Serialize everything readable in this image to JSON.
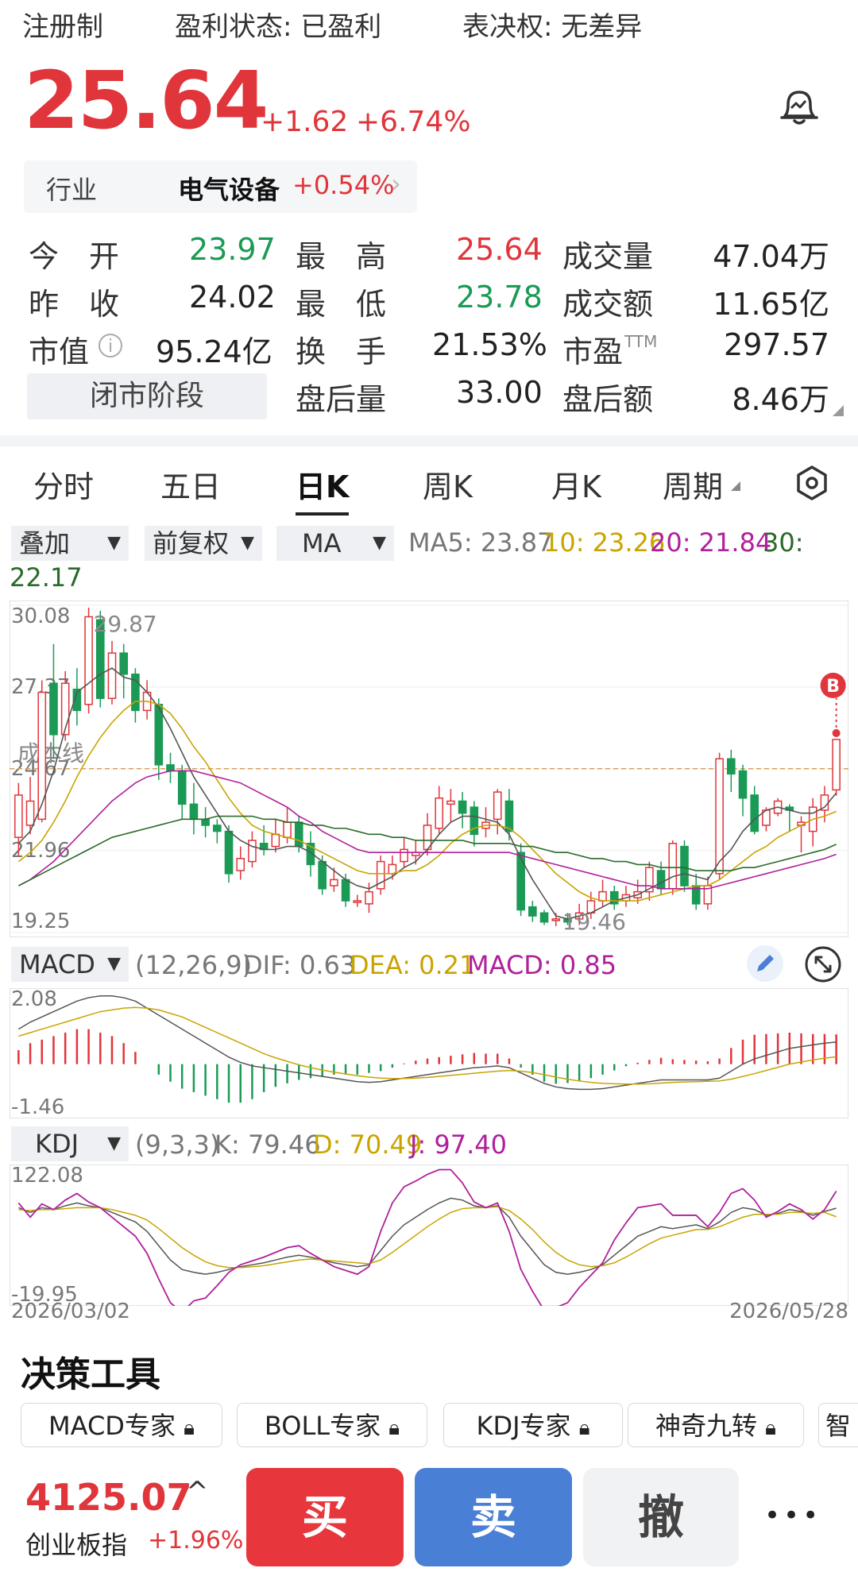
{
  "header": {
    "registration": "注册制",
    "profit_status": "盈利状态: 已盈利",
    "voting": "表决权: 无差异"
  },
  "price": {
    "current": "25.64",
    "change": "+1.62",
    "change_pct": "+6.74%"
  },
  "industry": {
    "label": "行业",
    "name": "电气设备",
    "change": "+0.54%"
  },
  "quote": {
    "open_label": "今　开",
    "open": "23.97",
    "high_label": "最　高",
    "high": "25.64",
    "volume_label": "成交量",
    "volume": "47.04万",
    "prev_close_label": "昨　收",
    "prev_close": "24.02",
    "low_label": "最　低",
    "low": "23.78",
    "turnover_label": "成交额",
    "turnover": "11.65亿",
    "mktcap_label": "市值",
    "mktcap": "95.24亿",
    "turnover_rate_label": "换　手",
    "turnover_rate": "21.53%",
    "pe_label": "市盈",
    "pe_suffix": "TTM",
    "pe": "297.57",
    "closed_label": "闭市阶段",
    "after_vol_label": "盘后量",
    "after_vol": "33.00",
    "after_amt_label": "盘后额",
    "after_amt": "8.46万"
  },
  "tabs": [
    "分时",
    "五日",
    "日K",
    "周K",
    "月K",
    "周期"
  ],
  "chart_controls": {
    "overlay": "叠加",
    "adjust": "前复权",
    "indicator": "MA",
    "ma5": "MA5: 23.87",
    "ma10": "10: 23.26",
    "ma20": "20: 21.84",
    "ma30_label": "30:",
    "ma30": "22.17"
  },
  "colors": {
    "up": "#e0353b",
    "down": "#1a9a55",
    "ma5": "#555555",
    "ma10": "#c9a400",
    "ma20": "#b0209a",
    "ma30": "#2a6a2a",
    "buy_button": "#e8373c",
    "sell_button": "#4a7fd6"
  },
  "chart_data": {
    "type": "candlestick",
    "y_ticks": [
      "30.08",
      "27.37",
      "24.67",
      "21.96",
      "19.25"
    ],
    "ylim": [
      19.25,
      30.08
    ],
    "max_label": "29.87",
    "min_label": "19.46",
    "cost_line_label": "成本线",
    "cost_line": 24.67,
    "signal_marker": "B",
    "x_start": "2026/03/02",
    "x_end": "2026/05/28",
    "candles": [
      [
        22.4,
        23.8,
        21.8,
        24.2
      ],
      [
        22.8,
        23.6,
        22.5,
        24.4
      ],
      [
        23.0,
        27.2,
        22.9,
        27.6
      ],
      [
        27.5,
        25.8,
        25.0,
        28.8
      ],
      [
        25.8,
        27.5,
        25.6,
        27.9
      ],
      [
        27.3,
        26.6,
        26.1,
        28.0
      ],
      [
        26.8,
        29.7,
        26.5,
        30.0
      ],
      [
        29.6,
        27.0,
        26.7,
        29.9
      ],
      [
        27.0,
        28.5,
        26.8,
        28.9
      ],
      [
        28.5,
        27.8,
        27.0,
        28.8
      ],
      [
        27.8,
        26.6,
        26.2,
        28.0
      ],
      [
        26.6,
        27.2,
        26.3,
        27.6
      ],
      [
        26.8,
        24.8,
        24.3,
        27.0
      ],
      [
        24.8,
        24.6,
        24.2,
        25.2
      ],
      [
        24.6,
        23.5,
        23.0,
        24.8
      ],
      [
        23.5,
        23.0,
        22.5,
        24.2
      ],
      [
        23.0,
        22.8,
        22.4,
        23.4
      ],
      [
        22.8,
        22.6,
        22.2,
        23.0
      ],
      [
        22.6,
        21.2,
        20.9,
        22.8
      ],
      [
        21.3,
        21.7,
        21.0,
        22.1
      ],
      [
        21.6,
        22.3,
        21.4,
        22.6
      ],
      [
        22.2,
        22.0,
        21.8,
        22.8
      ],
      [
        22.1,
        22.5,
        21.9,
        23.0
      ],
      [
        22.4,
        22.9,
        22.2,
        23.4
      ],
      [
        22.9,
        22.1,
        21.9,
        23.1
      ],
      [
        22.2,
        21.5,
        21.1,
        22.6
      ],
      [
        21.6,
        20.7,
        20.5,
        21.8
      ],
      [
        20.8,
        21.0,
        20.6,
        21.4
      ],
      [
        21.0,
        20.3,
        20.1,
        21.2
      ],
      [
        20.3,
        20.3,
        20.1,
        20.5
      ],
      [
        20.2,
        20.6,
        19.9,
        20.9
      ],
      [
        20.7,
        21.6,
        20.5,
        21.8
      ],
      [
        21.2,
        21.5,
        21.0,
        21.8
      ],
      [
        21.6,
        22.0,
        21.4,
        22.4
      ],
      [
        21.8,
        21.9,
        21.5,
        22.3
      ],
      [
        22.0,
        22.8,
        21.8,
        23.2
      ],
      [
        22.7,
        23.7,
        22.5,
        24.1
      ],
      [
        23.5,
        23.6,
        22.9,
        24.0
      ],
      [
        23.6,
        23.2,
        22.7,
        23.9
      ],
      [
        23.4,
        22.5,
        22.1,
        23.6
      ],
      [
        22.7,
        22.9,
        22.4,
        23.4
      ],
      [
        23.0,
        23.9,
        22.5,
        24.0
      ],
      [
        23.6,
        22.6,
        22.3,
        24.0
      ],
      [
        21.9,
        20.0,
        19.8,
        22.2
      ],
      [
        20.1,
        19.8,
        19.6,
        20.3
      ],
      [
        19.9,
        19.6,
        19.5,
        20.0
      ],
      [
        19.7,
        19.7,
        19.46,
        19.9
      ],
      [
        19.7,
        19.6,
        19.5,
        19.9
      ],
      [
        19.7,
        19.9,
        19.5,
        20.2
      ],
      [
        19.9,
        20.3,
        19.7,
        20.6
      ],
      [
        20.3,
        20.6,
        20.1,
        21.0
      ],
      [
        20.6,
        20.2,
        20.0,
        20.8
      ],
      [
        20.3,
        20.5,
        20.1,
        20.8
      ],
      [
        20.4,
        20.6,
        20.2,
        21.0
      ],
      [
        20.6,
        21.4,
        20.3,
        21.6
      ],
      [
        21.3,
        20.7,
        20.5,
        21.6
      ],
      [
        20.7,
        22.2,
        20.5,
        22.3
      ],
      [
        22.1,
        20.8,
        20.6,
        22.3
      ],
      [
        20.8,
        20.2,
        20.0,
        21.2
      ],
      [
        20.2,
        20.8,
        20.0,
        21.1
      ],
      [
        21.2,
        25.0,
        21.0,
        25.2
      ],
      [
        25.0,
        24.5,
        23.9,
        25.3
      ],
      [
        24.6,
        23.7,
        23.1,
        24.8
      ],
      [
        23.8,
        22.6,
        22.5,
        24.1
      ],
      [
        22.8,
        23.3,
        22.6,
        23.4
      ],
      [
        23.2,
        23.6,
        23.1,
        23.7
      ],
      [
        23.4,
        23.3,
        22.6,
        23.5
      ],
      [
        22.8,
        22.9,
        21.9,
        23.1
      ],
      [
        22.6,
        23.4,
        22.1,
        23.7
      ],
      [
        23.3,
        23.8,
        22.9,
        24.1
      ],
      [
        23.97,
        25.64,
        23.78,
        25.64
      ]
    ],
    "ma": {
      "MA5": [
        22.2,
        22.6,
        23.5,
        24.6,
        26.0,
        27.2,
        27.5,
        27.8,
        28.0,
        27.7,
        27.6,
        27.2,
        26.7,
        26.0,
        25.2,
        24.4,
        23.8,
        23.2,
        22.6,
        22.3,
        22.1,
        22.0,
        22.0,
        22.1,
        22.1,
        21.9,
        21.6,
        21.3,
        21.0,
        20.8,
        20.7,
        20.9,
        21.1,
        21.4,
        21.6,
        22.0,
        22.5,
        22.9,
        23.1,
        23.1,
        23.0,
        22.9,
        22.5,
        21.7,
        21.0,
        20.4,
        19.8,
        19.7,
        19.8,
        19.9,
        20.1,
        20.3,
        20.4,
        20.5,
        20.7,
        20.9,
        21.1,
        21.2,
        21.1,
        21.0,
        21.6,
        22.0,
        22.6,
        23.0,
        23.3,
        23.4,
        23.3,
        23.2,
        23.2,
        23.4,
        23.87
      ],
      "MA10": [
        21.6,
        21.9,
        22.3,
        22.9,
        23.6,
        24.4,
        25.1,
        25.7,
        26.2,
        26.6,
        26.9,
        26.9,
        26.8,
        26.5,
        26.0,
        25.4,
        24.9,
        24.3,
        23.7,
        23.2,
        22.8,
        22.6,
        22.5,
        22.4,
        22.3,
        22.1,
        21.9,
        21.7,
        21.5,
        21.3,
        21.2,
        21.2,
        21.2,
        21.3,
        21.3,
        21.5,
        21.8,
        22.2,
        22.5,
        22.7,
        22.8,
        22.8,
        22.7,
        22.4,
        22.0,
        21.6,
        21.2,
        20.9,
        20.6,
        20.4,
        20.3,
        20.3,
        20.3,
        20.3,
        20.4,
        20.5,
        20.6,
        20.7,
        20.8,
        20.8,
        21.0,
        21.3,
        21.6,
        21.9,
        22.1,
        22.4,
        22.6,
        22.8,
        23.0,
        23.1,
        23.26
      ],
      "MA20": [
        20.8,
        21.0,
        21.3,
        21.6,
        22.0,
        22.4,
        22.8,
        23.2,
        23.6,
        23.9,
        24.2,
        24.4,
        24.5,
        24.6,
        24.6,
        24.6,
        24.5,
        24.4,
        24.3,
        24.2,
        24.0,
        23.8,
        23.6,
        23.4,
        23.1,
        22.9,
        22.6,
        22.4,
        22.2,
        22.0,
        21.9,
        21.9,
        21.9,
        21.9,
        21.9,
        21.9,
        21.9,
        21.9,
        21.9,
        21.9,
        21.9,
        21.9,
        21.9,
        21.8,
        21.7,
        21.6,
        21.5,
        21.4,
        21.3,
        21.2,
        21.1,
        21.0,
        20.9,
        20.8,
        20.8,
        20.7,
        20.7,
        20.7,
        20.7,
        20.7,
        20.8,
        20.9,
        21.0,
        21.1,
        21.2,
        21.3,
        21.4,
        21.5,
        21.6,
        21.7,
        21.84
      ],
      "MA30": [
        20.8,
        21.0,
        21.2,
        21.4,
        21.6,
        21.8,
        22.0,
        22.2,
        22.4,
        22.5,
        22.6,
        22.7,
        22.8,
        22.9,
        23.0,
        23.0,
        23.0,
        23.1,
        23.1,
        23.1,
        23.1,
        23.0,
        23.0,
        22.9,
        22.9,
        22.8,
        22.8,
        22.7,
        22.7,
        22.6,
        22.5,
        22.5,
        22.4,
        22.4,
        22.3,
        22.3,
        22.3,
        22.3,
        22.3,
        22.2,
        22.2,
        22.2,
        22.2,
        22.1,
        22.1,
        22.0,
        21.9,
        21.9,
        21.8,
        21.7,
        21.7,
        21.6,
        21.6,
        21.5,
        21.5,
        21.4,
        21.4,
        21.4,
        21.3,
        21.3,
        21.3,
        21.3,
        21.4,
        21.4,
        21.5,
        21.6,
        21.7,
        21.8,
        21.9,
        22.0,
        22.17
      ]
    },
    "macd": {
      "label": "MACD",
      "params": "(12,26,9)",
      "dif_label": "DIF: 0.63",
      "dea_label": "DEA: 0.21",
      "macd_label": "MACD: 0.85",
      "y_ticks": [
        "2.08",
        "-1.46"
      ],
      "ylim": [
        -1.46,
        2.08
      ],
      "dif": [
        1.0,
        1.2,
        1.35,
        1.5,
        1.65,
        1.8,
        1.9,
        1.95,
        1.95,
        1.9,
        1.8,
        1.6,
        1.4,
        1.2,
        1.0,
        0.8,
        0.6,
        0.4,
        0.2,
        0.05,
        -0.05,
        -0.1,
        -0.15,
        -0.2,
        -0.25,
        -0.3,
        -0.35,
        -0.4,
        -0.45,
        -0.5,
        -0.52,
        -0.5,
        -0.45,
        -0.4,
        -0.35,
        -0.3,
        -0.25,
        -0.2,
        -0.15,
        -0.1,
        -0.08,
        -0.05,
        -0.1,
        -0.25,
        -0.4,
        -0.55,
        -0.65,
        -0.7,
        -0.72,
        -0.72,
        -0.7,
        -0.65,
        -0.6,
        -0.55,
        -0.5,
        -0.45,
        -0.45,
        -0.45,
        -0.45,
        -0.45,
        -0.4,
        -0.2,
        0.0,
        0.15,
        0.25,
        0.35,
        0.45,
        0.5,
        0.55,
        0.6,
        0.63
      ],
      "dea": [
        0.8,
        0.9,
        1.0,
        1.1,
        1.2,
        1.3,
        1.4,
        1.5,
        1.55,
        1.6,
        1.62,
        1.6,
        1.55,
        1.45,
        1.35,
        1.2,
        1.05,
        0.9,
        0.75,
        0.6,
        0.45,
        0.3,
        0.18,
        0.08,
        -0.02,
        -0.1,
        -0.17,
        -0.23,
        -0.28,
        -0.33,
        -0.37,
        -0.4,
        -0.41,
        -0.41,
        -0.4,
        -0.38,
        -0.35,
        -0.32,
        -0.29,
        -0.26,
        -0.23,
        -0.2,
        -0.18,
        -0.2,
        -0.24,
        -0.3,
        -0.37,
        -0.43,
        -0.48,
        -0.52,
        -0.55,
        -0.56,
        -0.57,
        -0.57,
        -0.56,
        -0.54,
        -0.52,
        -0.51,
        -0.5,
        -0.49,
        -0.48,
        -0.43,
        -0.35,
        -0.27,
        -0.18,
        -0.09,
        0.0,
        0.06,
        0.12,
        0.17,
        0.21
      ],
      "hist": [
        0.4,
        0.6,
        0.7,
        0.8,
        0.9,
        1.0,
        1.0,
        0.9,
        0.8,
        0.6,
        0.35,
        0.0,
        -0.3,
        -0.5,
        -0.7,
        -0.8,
        -0.9,
        -1.0,
        -1.1,
        -1.1,
        -1.0,
        -0.8,
        -0.65,
        -0.55,
        -0.45,
        -0.4,
        -0.35,
        -0.3,
        -0.3,
        -0.3,
        -0.25,
        -0.2,
        -0.1,
        0.02,
        0.1,
        0.16,
        0.2,
        0.24,
        0.28,
        0.32,
        0.3,
        0.3,
        0.16,
        -0.1,
        -0.3,
        -0.5,
        -0.56,
        -0.54,
        -0.48,
        -0.4,
        -0.3,
        -0.18,
        -0.06,
        0.04,
        0.12,
        0.18,
        0.14,
        0.12,
        0.1,
        0.08,
        0.16,
        0.46,
        0.7,
        0.84,
        0.86,
        0.88,
        0.9,
        0.88,
        0.86,
        0.86,
        0.85
      ]
    },
    "kdj": {
      "label": "KDJ",
      "params": "(9,3,3)",
      "k_label": "K: 79.46",
      "d_label": "D: 70.49",
      "j_label": "J: 97.40",
      "y_ticks": [
        "122.08",
        "-19.95"
      ],
      "ylim": [
        -19.95,
        122.08
      ],
      "k": [
        80,
        75,
        80,
        78,
        82,
        85,
        82,
        80,
        75,
        70,
        65,
        55,
        40,
        25,
        15,
        12,
        10,
        12,
        15,
        18,
        20,
        22,
        25,
        28,
        30,
        28,
        25,
        22,
        20,
        18,
        20,
        35,
        50,
        62,
        70,
        78,
        85,
        90,
        88,
        82,
        80,
        82,
        70,
        50,
        35,
        20,
        12,
        10,
        12,
        15,
        20,
        30,
        40,
        50,
        55,
        60,
        58,
        60,
        62,
        58,
        65,
        75,
        80,
        78,
        72,
        74,
        78,
        76,
        72,
        76,
        79.46
      ],
      "d": [
        78,
        77,
        78,
        78,
        79,
        80,
        80,
        80,
        78,
        75,
        72,
        67,
        58,
        48,
        38,
        30,
        23,
        19,
        17,
        17,
        18,
        19,
        21,
        23,
        25,
        26,
        25,
        24,
        23,
        22,
        21,
        25,
        33,
        42,
        51,
        60,
        68,
        75,
        79,
        80,
        80,
        81,
        77,
        68,
        57,
        44,
        33,
        25,
        20,
        18,
        19,
        22,
        28,
        35,
        42,
        48,
        51,
        54,
        57,
        57,
        60,
        65,
        70,
        73,
        73,
        73,
        75,
        75,
        74,
        75,
        70.49
      ],
      "j": [
        85,
        70,
        84,
        78,
        88,
        95,
        86,
        80,
        70,
        60,
        50,
        32,
        5,
        -20,
        -30,
        -18,
        -15,
        -2,
        12,
        20,
        24,
        28,
        33,
        38,
        40,
        32,
        25,
        18,
        14,
        10,
        18,
        55,
        85,
        102,
        108,
        115,
        120,
        120,
        106,
        86,
        80,
        85,
        55,
        15,
        -8,
        -28,
        -25,
        -20,
        -4,
        9,
        22,
        46,
        64,
        80,
        82,
        84,
        72,
        72,
        72,
        60,
        75,
        95,
        100,
        88,
        70,
        76,
        84,
        78,
        68,
        78,
        97.4
      ]
    }
  },
  "decision_tools": {
    "title": "决策工具",
    "items": [
      "MACD专家",
      "BOLL专家",
      "KDJ专家",
      "神奇九转",
      "智"
    ]
  },
  "bottom": {
    "index_value": "4125.07",
    "index_name": "创业板指",
    "index_change": "+1.96%",
    "buy": "买",
    "sell": "卖",
    "cancel": "撤",
    "more": "•••"
  }
}
